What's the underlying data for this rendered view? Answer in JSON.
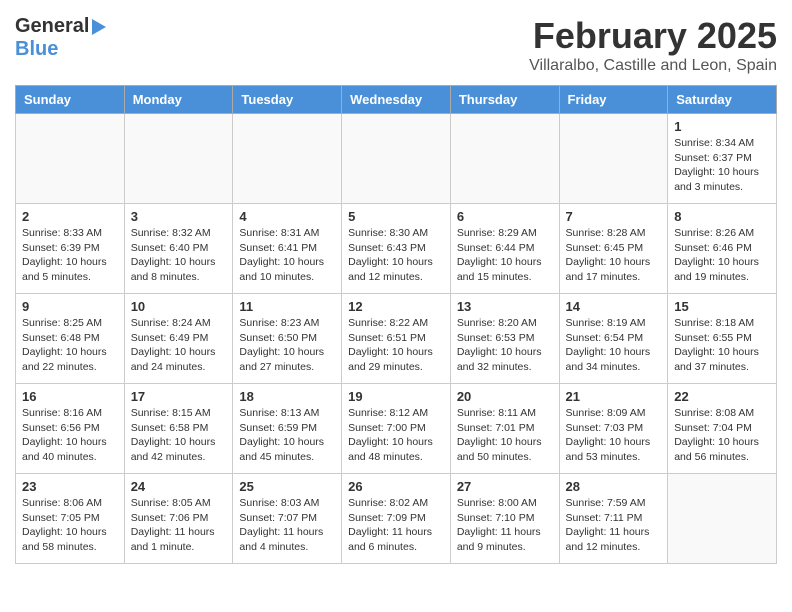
{
  "header": {
    "logo_general": "General",
    "logo_blue": "Blue",
    "month_title": "February 2025",
    "subtitle": "Villaralbo, Castille and Leon, Spain"
  },
  "weekdays": [
    "Sunday",
    "Monday",
    "Tuesday",
    "Wednesday",
    "Thursday",
    "Friday",
    "Saturday"
  ],
  "weeks": [
    [
      {
        "day": "",
        "info": ""
      },
      {
        "day": "",
        "info": ""
      },
      {
        "day": "",
        "info": ""
      },
      {
        "day": "",
        "info": ""
      },
      {
        "day": "",
        "info": ""
      },
      {
        "day": "",
        "info": ""
      },
      {
        "day": "1",
        "info": "Sunrise: 8:34 AM\nSunset: 6:37 PM\nDaylight: 10 hours\nand 3 minutes."
      }
    ],
    [
      {
        "day": "2",
        "info": "Sunrise: 8:33 AM\nSunset: 6:39 PM\nDaylight: 10 hours\nand 5 minutes."
      },
      {
        "day": "3",
        "info": "Sunrise: 8:32 AM\nSunset: 6:40 PM\nDaylight: 10 hours\nand 8 minutes."
      },
      {
        "day": "4",
        "info": "Sunrise: 8:31 AM\nSunset: 6:41 PM\nDaylight: 10 hours\nand 10 minutes."
      },
      {
        "day": "5",
        "info": "Sunrise: 8:30 AM\nSunset: 6:43 PM\nDaylight: 10 hours\nand 12 minutes."
      },
      {
        "day": "6",
        "info": "Sunrise: 8:29 AM\nSunset: 6:44 PM\nDaylight: 10 hours\nand 15 minutes."
      },
      {
        "day": "7",
        "info": "Sunrise: 8:28 AM\nSunset: 6:45 PM\nDaylight: 10 hours\nand 17 minutes."
      },
      {
        "day": "8",
        "info": "Sunrise: 8:26 AM\nSunset: 6:46 PM\nDaylight: 10 hours\nand 19 minutes."
      }
    ],
    [
      {
        "day": "9",
        "info": "Sunrise: 8:25 AM\nSunset: 6:48 PM\nDaylight: 10 hours\nand 22 minutes."
      },
      {
        "day": "10",
        "info": "Sunrise: 8:24 AM\nSunset: 6:49 PM\nDaylight: 10 hours\nand 24 minutes."
      },
      {
        "day": "11",
        "info": "Sunrise: 8:23 AM\nSunset: 6:50 PM\nDaylight: 10 hours\nand 27 minutes."
      },
      {
        "day": "12",
        "info": "Sunrise: 8:22 AM\nSunset: 6:51 PM\nDaylight: 10 hours\nand 29 minutes."
      },
      {
        "day": "13",
        "info": "Sunrise: 8:20 AM\nSunset: 6:53 PM\nDaylight: 10 hours\nand 32 minutes."
      },
      {
        "day": "14",
        "info": "Sunrise: 8:19 AM\nSunset: 6:54 PM\nDaylight: 10 hours\nand 34 minutes."
      },
      {
        "day": "15",
        "info": "Sunrise: 8:18 AM\nSunset: 6:55 PM\nDaylight: 10 hours\nand 37 minutes."
      }
    ],
    [
      {
        "day": "16",
        "info": "Sunrise: 8:16 AM\nSunset: 6:56 PM\nDaylight: 10 hours\nand 40 minutes."
      },
      {
        "day": "17",
        "info": "Sunrise: 8:15 AM\nSunset: 6:58 PM\nDaylight: 10 hours\nand 42 minutes."
      },
      {
        "day": "18",
        "info": "Sunrise: 8:13 AM\nSunset: 6:59 PM\nDaylight: 10 hours\nand 45 minutes."
      },
      {
        "day": "19",
        "info": "Sunrise: 8:12 AM\nSunset: 7:00 PM\nDaylight: 10 hours\nand 48 minutes."
      },
      {
        "day": "20",
        "info": "Sunrise: 8:11 AM\nSunset: 7:01 PM\nDaylight: 10 hours\nand 50 minutes."
      },
      {
        "day": "21",
        "info": "Sunrise: 8:09 AM\nSunset: 7:03 PM\nDaylight: 10 hours\nand 53 minutes."
      },
      {
        "day": "22",
        "info": "Sunrise: 8:08 AM\nSunset: 7:04 PM\nDaylight: 10 hours\nand 56 minutes."
      }
    ],
    [
      {
        "day": "23",
        "info": "Sunrise: 8:06 AM\nSunset: 7:05 PM\nDaylight: 10 hours\nand 58 minutes."
      },
      {
        "day": "24",
        "info": "Sunrise: 8:05 AM\nSunset: 7:06 PM\nDaylight: 11 hours\nand 1 minute."
      },
      {
        "day": "25",
        "info": "Sunrise: 8:03 AM\nSunset: 7:07 PM\nDaylight: 11 hours\nand 4 minutes."
      },
      {
        "day": "26",
        "info": "Sunrise: 8:02 AM\nSunset: 7:09 PM\nDaylight: 11 hours\nand 6 minutes."
      },
      {
        "day": "27",
        "info": "Sunrise: 8:00 AM\nSunset: 7:10 PM\nDaylight: 11 hours\nand 9 minutes."
      },
      {
        "day": "28",
        "info": "Sunrise: 7:59 AM\nSunset: 7:11 PM\nDaylight: 11 hours\nand 12 minutes."
      },
      {
        "day": "",
        "info": ""
      }
    ]
  ]
}
